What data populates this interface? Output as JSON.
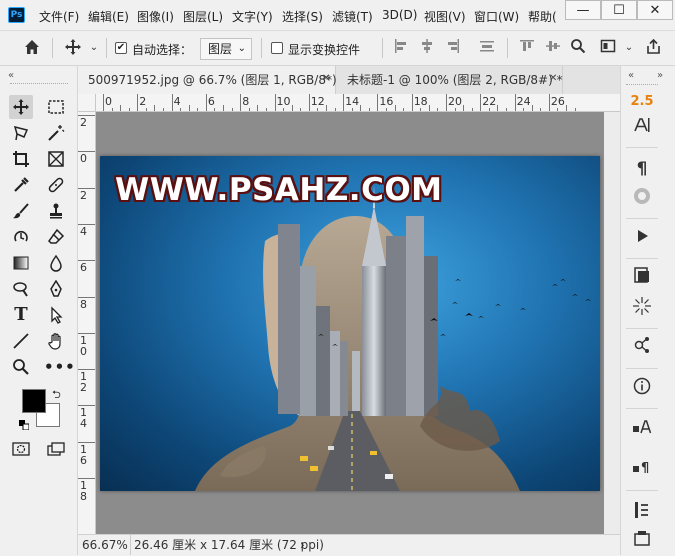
{
  "app": {
    "logo": "Ps"
  },
  "menu": [
    "文件(F)",
    "编辑(E)",
    "图像(I)",
    "图层(L)",
    "文字(Y)",
    "选择(S)",
    "滤镜(T)",
    "3D(D)",
    "视图(V)",
    "窗口(W)",
    "帮助("
  ],
  "window_controls": {
    "minimize": "—",
    "maximize": "☐",
    "close": "✕"
  },
  "options": {
    "auto_select_label": "自动选择：",
    "auto_select_checked": true,
    "auto_select_target": "图层",
    "show_transform_label": "显示变换控件",
    "show_transform_checked": false
  },
  "tabs": [
    {
      "label": "500971952.jpg @ 66.7% (图层 1, RGB/8*) *",
      "close": "✕",
      "active": true
    },
    {
      "label": "未标题-1 @ 100% (图层 2, RGB/8#) *",
      "close": "✕",
      "active": false
    }
  ],
  "ruler": {
    "h_labels": [
      "0",
      "2",
      "4",
      "6",
      "8",
      "10",
      "12",
      "14",
      "16",
      "18",
      "20",
      "22",
      "24",
      "26"
    ],
    "v_labels": [
      "2",
      "0",
      "2",
      "4",
      "6",
      "8",
      "1 0",
      "1 2",
      "1 4",
      "1 6",
      "1 8"
    ]
  },
  "canvas": {
    "overlay_text": "WWW.PSAHZ.COM"
  },
  "status": {
    "zoom": "66.67%",
    "doc_info": "26.46 厘米 x 17.64 厘米 (72 ppi)",
    "arrow": "›"
  },
  "right_panel": {
    "version_value": "2.5"
  },
  "colors": {
    "foreground": "#000000",
    "background": "#ffffff",
    "tab_active_bg": "#f0f0f0",
    "accent_orange": "#e8820c"
  }
}
